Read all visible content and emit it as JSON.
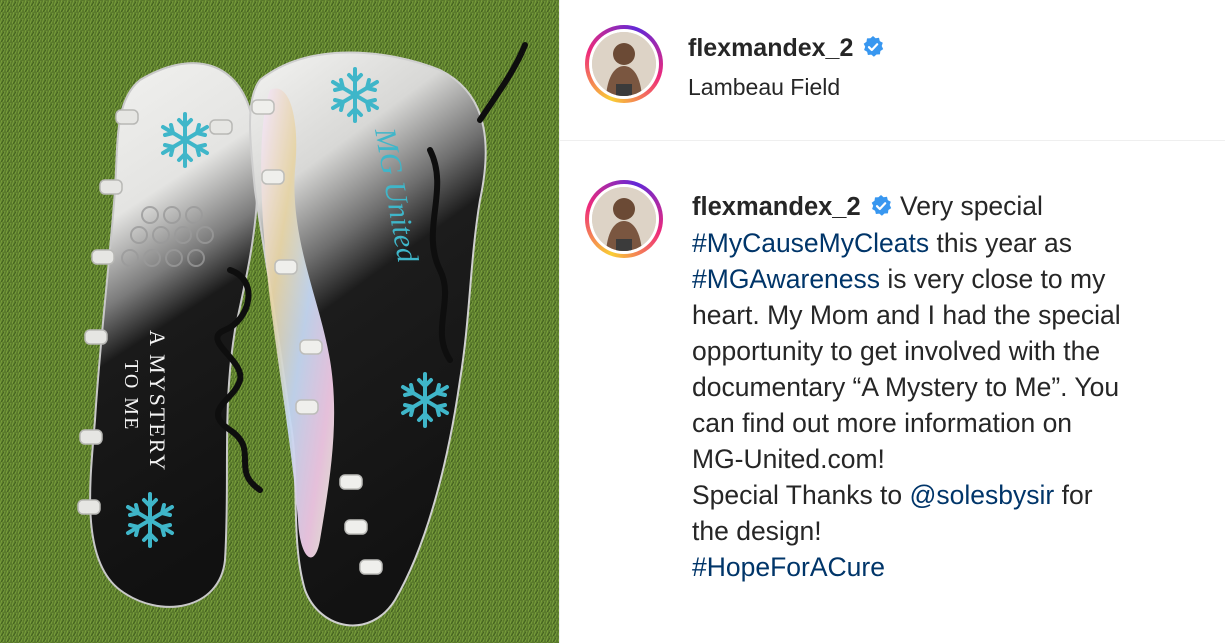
{
  "post": {
    "username": "flexmandex_2",
    "location": "Lambeau Field",
    "verified": true
  },
  "caption": {
    "username": "flexmandex_2",
    "intro": " Very special",
    "tag_mycause": "#MyCauseMyCleats",
    "text_this_year": " this year as",
    "tag_mgawareness": "#MGAwareness",
    "text_close": " is very close to my",
    "line_heart": "heart. My Mom and I had the special",
    "line_opportunity": "opportunity to get involved with the",
    "line_documentary": "documentary “A Mystery to Me”. You",
    "line_find": "can find out more information on",
    "line_site": "MG-United.com!",
    "text_thanks": "Special Thanks to ",
    "mention": "@solesbysir",
    "text_for": " for",
    "line_design": "the design!",
    "tag_hope": "#HopeForACure"
  },
  "photo": {
    "cleat_text_left": "A MYSTERY TO ME",
    "cleat_text_right": "MG United"
  },
  "colors": {
    "link": "#003569",
    "verified_blue": "#3897f0",
    "divider": "#efefef",
    "text": "#262626"
  },
  "icons": [
    "verified-badge-icon",
    "snowflake-icon"
  ]
}
